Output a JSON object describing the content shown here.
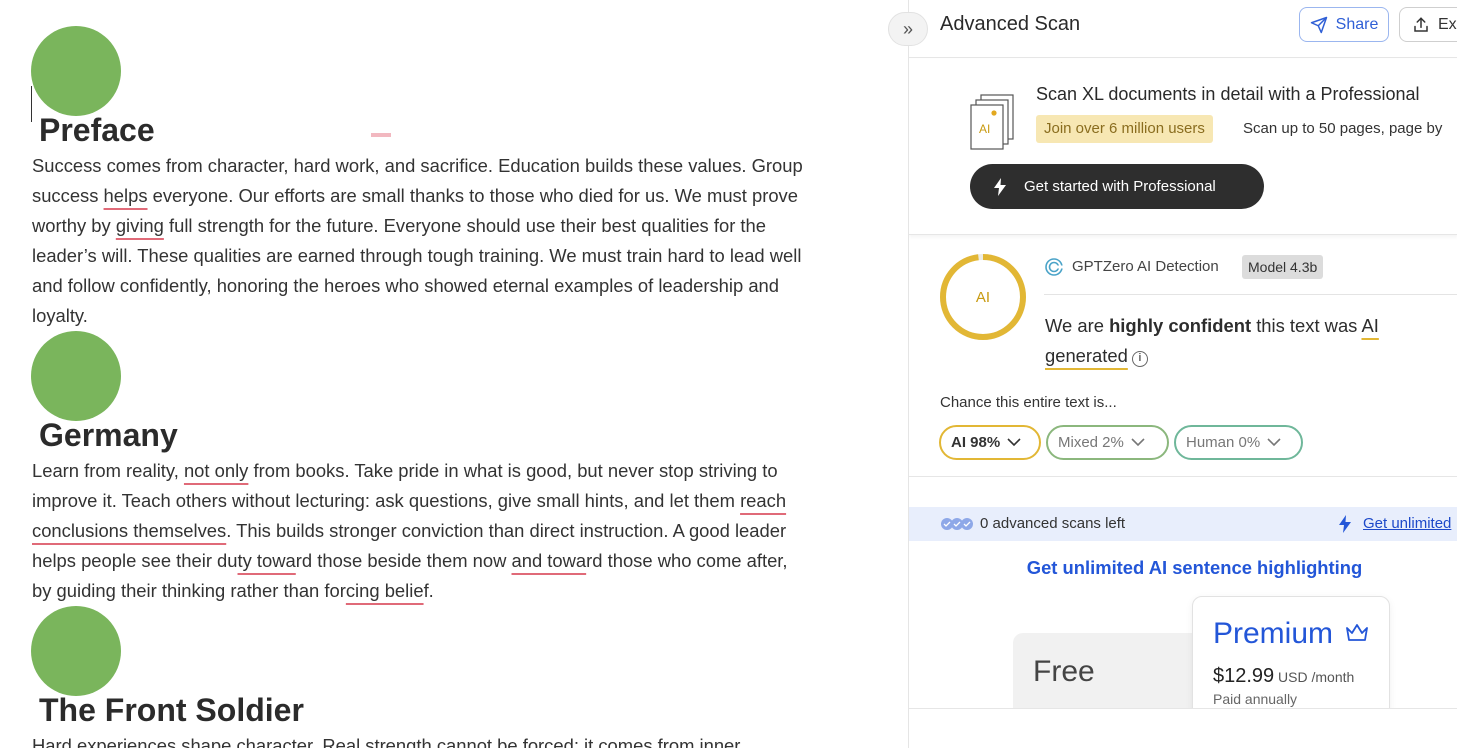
{
  "editor": {
    "sections": [
      {
        "title": "Preface",
        "lines": [
          [
            " Success comes from character, hard work, and sacrifice. Education builds these values. Group"
          ],
          [
            "success ",
            "_helps",
            " everyone. Our efforts are small thanks to those who died for us. We must prove"
          ],
          [
            "worthy by ",
            "_giving",
            " full strength for the future. Everyone should use their best qualities for the"
          ],
          [
            "leader’s will. These qualities are earned through tough training. We must train hard to lead well"
          ],
          [
            "and follow confidently, honoring the heroes who showed eternal examples of leadership and"
          ],
          [
            "loyalty."
          ]
        ]
      },
      {
        "title": "Germany",
        "lines": [
          [
            " Learn from reality, ",
            "_not only",
            " from books. Take pride in what is good, but never stop striving to"
          ],
          [
            "improve it. Teach others without lecturing: ask questions, give small hints, and let them ",
            "_reach"
          ],
          [
            "_conclusions themselves",
            ". This builds stronger conviction than direct instruction. A good leader"
          ],
          [
            "helps people see their du",
            "_ty towa",
            "rd those beside them now ",
            "_and towa",
            "rd those who come after,"
          ],
          [
            "by guiding their thinking rather than for",
            "_cing belie",
            "f."
          ]
        ]
      },
      {
        "title": "The Front Soldier",
        "lines": [
          [
            " Hard experiences shape character. Real strength cannot be forced; it comes from inner"
          ]
        ]
      }
    ]
  },
  "panel": {
    "title": "Advanced Scan",
    "share_label": "Share",
    "export_label": "Exp",
    "promo": {
      "title": "Scan XL documents in detail with a Professional",
      "badge": "Join over 6 million users",
      "subtitle": "Scan up to 50 pages, page by",
      "button_label": "Get started with Professional",
      "doc_icon_text": "AI"
    },
    "result": {
      "ring_label": "AI",
      "ring_fraction": 0.98,
      "detector_name": "GPTZero AI Detection",
      "model_badge": "Model 4.3b",
      "verdict_prefix": "We are ",
      "verdict_confidence": "highly confident",
      "verdict_middle": " this text was ",
      "verdict_ai": "AI",
      "verdict_generated": "generated",
      "chance_label": "Chance this entire text is...",
      "pills": {
        "ai": "AI 98%",
        "mixed": "Mixed 2%",
        "human": "Human 0%"
      }
    },
    "scans": {
      "remaining_text": "0 advanced scans left",
      "link_text": "Get unlimited"
    },
    "upsell": {
      "headline": "Get unlimited AI sentence highlighting",
      "free_name": "Free",
      "premium_name": "Premium",
      "premium_price": "$12.99",
      "premium_period": " USD /month",
      "premium_billing": "Paid annually"
    }
  },
  "colors": {
    "accent_blue": "#2356d8",
    "ai_yellow": "#e2b735",
    "dot_green": "#7ab55c",
    "underline_red": "#e06a78"
  }
}
